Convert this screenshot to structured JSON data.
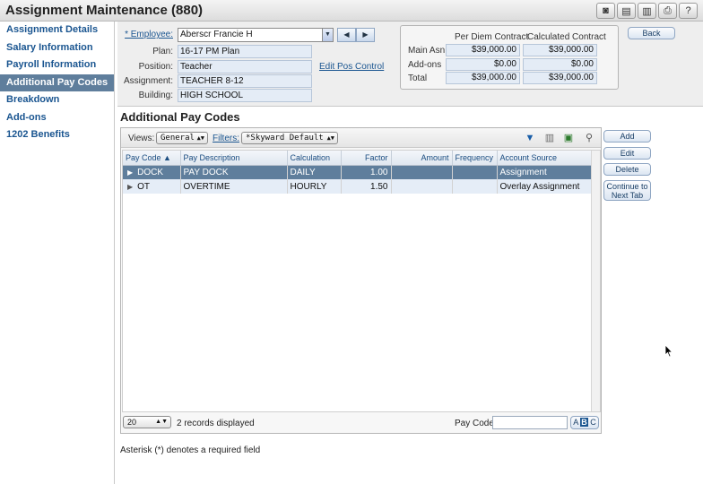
{
  "window": {
    "title": "Assignment Maintenance (880)",
    "toolbar_icons": [
      "camera-icon",
      "copy-icon",
      "paste-icon",
      "print-icon",
      "help-icon"
    ],
    "toolbar_glyphs": [
      "◙",
      "▤",
      "▥",
      "⎙",
      "?"
    ]
  },
  "sidebar": {
    "items": [
      {
        "label": "Assignment Details",
        "active": false
      },
      {
        "label": "Salary Information",
        "active": false
      },
      {
        "label": "Payroll Information",
        "active": false
      },
      {
        "label": "Additional Pay Codes",
        "active": true
      },
      {
        "label": "Breakdown",
        "active": false
      },
      {
        "label": "Add-ons",
        "active": false
      },
      {
        "label": "1202 Benefits",
        "active": false
      }
    ]
  },
  "header": {
    "employee_label": "* Employee:",
    "employee_value": "Aberscr Francie H",
    "plan_label": "Plan:",
    "plan_value": "16-17 PM Plan",
    "position_label": "Position:",
    "position_value": "Teacher",
    "edit_pos_control": "Edit Pos Control",
    "assignment_label": "Assignment:",
    "assignment_value": "TEACHER 8-12",
    "building_label": "Building:",
    "building_value": "HIGH SCHOOL",
    "back_button": "Back"
  },
  "contract": {
    "col1": "Per Diem Contract",
    "col2": "Calculated Contract",
    "rows": [
      {
        "label": "Main Asn",
        "per_diem": "$39,000.00",
        "calculated": "$39,000.00"
      },
      {
        "label": "Add-ons",
        "per_diem": "$0.00",
        "calculated": "$0.00"
      },
      {
        "label": "Total",
        "per_diem": "$39,000.00",
        "calculated": "$39,000.00"
      }
    ]
  },
  "section": {
    "title": "Additional Pay Codes"
  },
  "grid": {
    "views_label": "Views:",
    "views_value": "General",
    "filters_label": "Filters:",
    "filters_value": "*Skyward Default",
    "columns": [
      "Pay Code ▲",
      "Pay Description",
      "Calculation",
      "Factor",
      "Amount",
      "Frequency",
      "Account Source"
    ],
    "rows": [
      {
        "code": "DOCK",
        "description": "PAY DOCK",
        "calculation": "DAILY",
        "factor": "1.00",
        "amount": "",
        "frequency": "",
        "account_source": "Assignment",
        "selected": true
      },
      {
        "code": "OT",
        "description": "OVERTIME",
        "calculation": "HOURLY",
        "factor": "1.50",
        "amount": "",
        "frequency": "",
        "account_source": "Overlay Assignment",
        "selected": false
      }
    ],
    "page_size": "20",
    "records_text": "2 records displayed",
    "pay_code_label": "Pay Code:",
    "pay_code_value": "",
    "abc_prefix": "A",
    "abc_mid": "B",
    "abc_suffix": "C"
  },
  "actions": {
    "add": "Add",
    "edit": "Edit",
    "delete": "Delete",
    "continue_line1": "Continue to",
    "continue_line2": "Next Tab"
  },
  "footer": {
    "note": "Asterisk (*) denotes a required field"
  }
}
